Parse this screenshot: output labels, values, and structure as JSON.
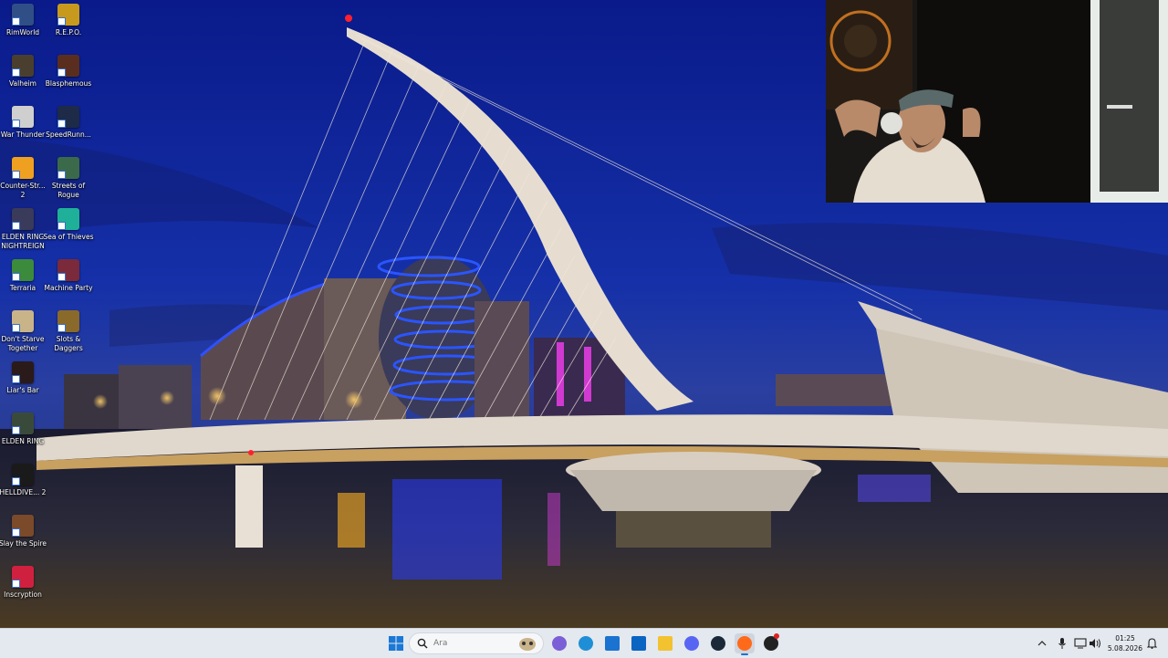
{
  "desktop": {
    "icons": [
      {
        "label": "RimWorld",
        "icon": "rimworld-icon",
        "color": "#2f4f86"
      },
      {
        "label": "R.E.P.O.",
        "icon": "repo-icon",
        "color": "#c79a1d"
      },
      {
        "label": "Valheim",
        "icon": "valheim-icon",
        "color": "#4a3f2e"
      },
      {
        "label": "Blasphemous",
        "icon": "blasphemous-icon",
        "color": "#5a2e1e"
      },
      {
        "label": "War Thunder",
        "icon": "war-thunder-icon",
        "color": "#cfcfcf"
      },
      {
        "label": "SpeedRunn...",
        "icon": "speedrunners-icon",
        "color": "#1d2a48"
      },
      {
        "label": "Counter-Str... 2",
        "icon": "counter-strike-icon",
        "color": "#f0a020"
      },
      {
        "label": "Streets of Rogue",
        "icon": "streets-of-rogue-icon",
        "color": "#3b6a4a"
      },
      {
        "label": "ELDEN RING NIGHTREIGN",
        "icon": "elden-ring-nightreign-icon",
        "color": "#3a3a5a"
      },
      {
        "label": "Sea of Thieves",
        "icon": "sea-of-thieves-icon",
        "color": "#1fb09a"
      },
      {
        "label": "Terraria",
        "icon": "terraria-icon",
        "color": "#3c8a3c"
      },
      {
        "label": "Machine Party",
        "icon": "machine-party-icon",
        "color": "#7a2a3a"
      },
      {
        "label": "Don't Starve Together",
        "icon": "dont-starve-together-icon",
        "color": "#c9b48a"
      },
      {
        "label": "Slots & Daggers",
        "icon": "slots-and-daggers-icon",
        "color": "#8a6a2a"
      },
      {
        "label": "Liar's Bar",
        "icon": "liars-bar-icon",
        "color": "#2a1a1a"
      },
      {
        "label": "ELDEN RING",
        "icon": "elden-ring-icon",
        "color": "#3a4a3a"
      },
      {
        "label": "HELLDIVE... 2",
        "icon": "helldivers-2-icon",
        "color": "#1a1a1a"
      },
      {
        "label": "Slay the Spire",
        "icon": "slay-the-spire-icon",
        "color": "#7a4a2a"
      },
      {
        "label": "Inscryption",
        "icon": "inscryption-icon",
        "color": "#d02040"
      }
    ]
  },
  "taskbar": {
    "search_placeholder": "Ara",
    "apps": [
      {
        "name": "widgets-icon",
        "color": "#7a5fd6"
      },
      {
        "name": "edge-icon",
        "color": "#1e8fd6"
      },
      {
        "name": "store-icon",
        "color": "#1a73d0"
      },
      {
        "name": "outlook-icon",
        "color": "#0a64c2"
      },
      {
        "name": "file-explorer-icon",
        "color": "#f2c230"
      },
      {
        "name": "discord-icon",
        "color": "#5865f2"
      },
      {
        "name": "steam-icon",
        "color": "#1b2838"
      },
      {
        "name": "firefox-icon",
        "color": "#ff6a1a"
      },
      {
        "name": "obs-icon",
        "color": "#222222"
      }
    ],
    "clock": {
      "time": "01:25",
      "date": "5.08.2026"
    }
  }
}
